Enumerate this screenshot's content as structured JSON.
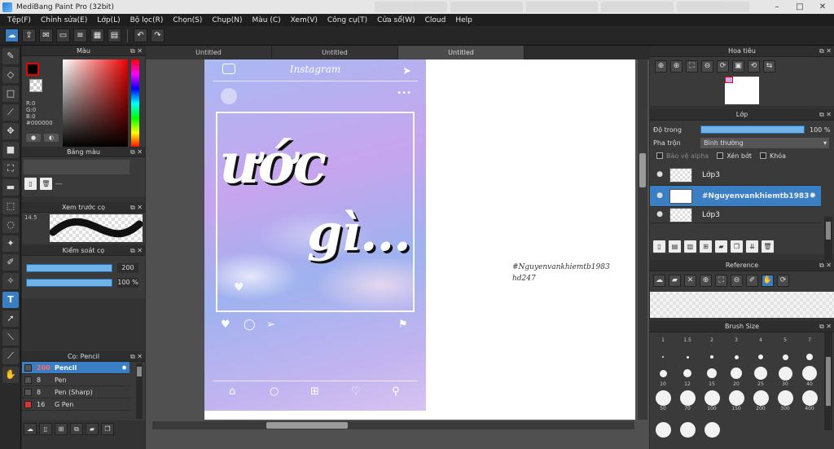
{
  "window": {
    "title": "MediBang Paint Pro (32bit)"
  },
  "menu": [
    "Tệp(F)",
    "Chỉnh sửa(E)",
    "Lớp(L)",
    "Bộ lọc(R)",
    "Chọn(S)",
    "Chụp(N)",
    "Màu (C)",
    "Xem(V)",
    "Công cụ(T)",
    "Cửa sổ(W)",
    "Cloud",
    "Help"
  ],
  "panels": {
    "color": {
      "title": "Màu",
      "rgb_text": "R:0\nG:0\nB:0\n#000000",
      "fg_color": "#000000",
      "accent": "#e00000"
    },
    "palette": {
      "title": "Bảng màu",
      "name": "---"
    },
    "preview": {
      "title": "Xem trước cọ",
      "size": "14.5"
    },
    "control": {
      "title": "Kiểm soát cọ",
      "size_value": "200",
      "opacity_value": "100 %"
    },
    "brushes": {
      "title": "Cọ: Pencil",
      "items": [
        {
          "size": "200",
          "name": "Pencil",
          "selected": true,
          "color": "#333333"
        },
        {
          "size": "8",
          "name": "Pen",
          "selected": false,
          "color": "#333333"
        },
        {
          "size": "8",
          "name": "Pen (Sharp)",
          "selected": false,
          "color": "#333333"
        },
        {
          "size": "16",
          "name": "G Pen",
          "selected": false,
          "color": "#e03030"
        }
      ]
    },
    "navigator": {
      "title": "Hoa tiêu"
    },
    "layers": {
      "title": "Lớp",
      "opacity_label": "Độ trong",
      "opacity_value": "100 %",
      "opacity": 1.0,
      "blend_label": "Pha trộn",
      "blend_value": "Bình thường",
      "protect_alpha": "Bảo vệ alpha",
      "clipping": "Xén bớt",
      "lock": "Khóa",
      "items": [
        {
          "name": "Lớp3",
          "selected": false
        },
        {
          "name": "#Nguyenvankhiemtb1983",
          "selected": true
        },
        {
          "name": "Lớp3",
          "selected": false
        }
      ]
    },
    "reference": {
      "title": "Reference"
    },
    "brush_size": {
      "title": "Brush Size",
      "row_labels": [
        [
          "1",
          "1.5",
          "2",
          "3",
          "4",
          "5",
          "7"
        ],
        [
          "10",
          "12",
          "15",
          "20",
          "25",
          "30",
          "40"
        ],
        [
          "50",
          "70",
          "100",
          "150",
          "200",
          "300",
          "400"
        ]
      ]
    }
  },
  "canvas": {
    "tabs": [
      "Untitled",
      "Untitled",
      "Untitled"
    ],
    "active_tab": 2,
    "ig_header": "Instagram",
    "big_text_line1": "ước",
    "big_text_line2": "gì...",
    "side_text_line1": "#Nguyenvankhiemtb1983",
    "side_text_line2": "hd247"
  }
}
